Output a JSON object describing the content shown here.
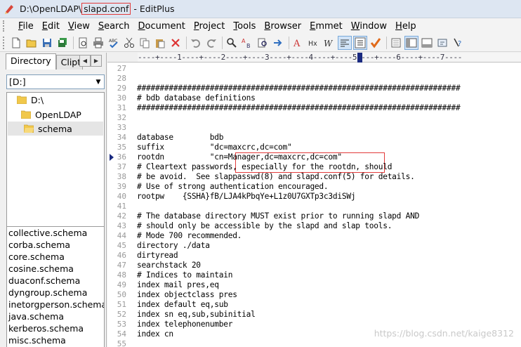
{
  "window": {
    "path_prefix": "D:\\OpenLDAP\\",
    "file_name": "slapd.conf",
    "app_suffix": " - EditPlus"
  },
  "menu": [
    {
      "label": "File"
    },
    {
      "label": "Edit"
    },
    {
      "label": "View"
    },
    {
      "label": "Search"
    },
    {
      "label": "Document"
    },
    {
      "label": "Project"
    },
    {
      "label": "Tools"
    },
    {
      "label": "Browser"
    },
    {
      "label": "Emmet"
    },
    {
      "label": "Window"
    },
    {
      "label": "Help"
    }
  ],
  "toolbar": {
    "icons": [
      "new-file-icon",
      "open-file-icon",
      "save-icon",
      "save-all-icon",
      "print-preview-icon",
      "print-icon",
      "spell-check-icon",
      "cut-icon",
      "copy-icon",
      "paste-icon",
      "delete-icon",
      "undo-icon",
      "redo-icon",
      "find-icon",
      "replace-icon",
      "find-in-files-icon",
      "goto-icon",
      "font-icon",
      "hex-icon",
      "word-wrap-icon",
      "ruler-toggle-icon",
      "line-number-icon",
      "check-mark-icon",
      "outline-icon",
      "window-list-icon",
      "output-window-icon",
      "clip-icon",
      "help-icon"
    ],
    "hx_label": "Hx",
    "w_label": "W",
    "a_label": "A"
  },
  "left_panel": {
    "tabs": [
      "Directory",
      "Cliptext"
    ],
    "drive": "[D:]",
    "tree": [
      {
        "label": "D:\\",
        "selected": false
      },
      {
        "label": "OpenLDAP",
        "selected": false
      },
      {
        "label": "schema",
        "selected": true
      }
    ],
    "files": [
      "collective.schema",
      "corba.schema",
      "core.schema",
      "cosine.schema",
      "duaconf.schema",
      "dyngroup.schema",
      "inetorgperson.schema",
      "java.schema",
      "kerberos.schema",
      "misc.schema"
    ]
  },
  "editor": {
    "ruler": "----+----1----+----2----+----3----+----4----+----5----+----6----+----7----",
    "current_line": 36,
    "lines": [
      {
        "n": "27",
        "text": ""
      },
      {
        "n": "28",
        "text": ""
      },
      {
        "n": "29",
        "text": "#######################################################################"
      },
      {
        "n": "30",
        "text": "# bdb database definitions"
      },
      {
        "n": "31",
        "text": "#######################################################################"
      },
      {
        "n": "32",
        "text": ""
      },
      {
        "n": "33",
        "text": ""
      },
      {
        "n": "34",
        "text": "database        bdb"
      },
      {
        "n": "35",
        "text": "suffix          \"dc=maxcrc,dc=com\""
      },
      {
        "n": "36",
        "text": "rootdn          \"cn=Manager,dc=maxcrc,dc=com\""
      },
      {
        "n": "37",
        "text": "# Cleartext passwords, especially for the rootdn, should"
      },
      {
        "n": "38",
        "text": "# be avoid.  See slappasswd(8) and slapd.conf(5) for details."
      },
      {
        "n": "39",
        "text": "# Use of strong authentication encouraged."
      },
      {
        "n": "40",
        "text": "rootpw    {SSHA}fB/LJA4kPbqYe+L1z0U7GXTp3c3diSWj"
      },
      {
        "n": "41",
        "text": ""
      },
      {
        "n": "42",
        "text": "# The database directory MUST exist prior to running slapd AND"
      },
      {
        "n": "43",
        "text": "# should only be accessible by the slapd and slap tools."
      },
      {
        "n": "44",
        "text": "# Mode 700 recommended."
      },
      {
        "n": "45",
        "text": "directory ./data"
      },
      {
        "n": "46",
        "text": "dirtyread"
      },
      {
        "n": "47",
        "text": "searchstack 20"
      },
      {
        "n": "48",
        "text": "# Indices to maintain"
      },
      {
        "n": "49",
        "text": "index mail pres,eq"
      },
      {
        "n": "50",
        "text": "index objectclass pres"
      },
      {
        "n": "51",
        "text": "index default eq,sub"
      },
      {
        "n": "52",
        "text": "index sn eq,sub,subinitial"
      },
      {
        "n": "53",
        "text": "index telephonenumber"
      },
      {
        "n": "54",
        "text": "index cn"
      },
      {
        "n": "55",
        "text": ""
      }
    ]
  },
  "watermark": "https://blog.csdn.net/kaige8312"
}
